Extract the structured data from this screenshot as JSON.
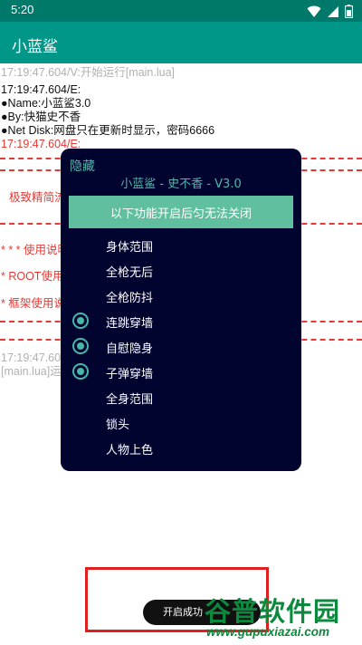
{
  "status_bar": {
    "time": "5:20",
    "icons": [
      "wifi-icon",
      "signal-icon",
      "battery-icon"
    ]
  },
  "app_bar": {
    "title": "小蓝鲨"
  },
  "log": {
    "lines": [
      "17:19:47.604/V:开始运行[main.lua]",
      "17:19:47.604/E:",
      "●Name:小蓝鲨3.0",
      "●By:快猫史不香",
      "●Net Disk:网盘只在更新时显示，密码6666",
      "17:19:47.604/E:",
      "极致精简流",
      "* * * 使用说明",
      "* ROOT使用",
      "* 框架使用说",
      "17:19:47.60",
      "[main.lua]运"
    ]
  },
  "dialog": {
    "hide_label": "隐藏",
    "title": "小蓝鲨 - 史不香 - V3.0",
    "banner": "以下功能开启后匀无法关闭",
    "options": [
      {
        "label": "身体范围",
        "checked": false
      },
      {
        "label": "全枪无后",
        "checked": false
      },
      {
        "label": "全枪防抖",
        "checked": false
      },
      {
        "label": "连跳穿墙",
        "checked": true
      },
      {
        "label": "自慰隐身",
        "checked": true
      },
      {
        "label": "子弹穿墙",
        "checked": true
      },
      {
        "label": "全身范围",
        "checked": false
      },
      {
        "label": "锁头",
        "checked": false
      },
      {
        "label": "人物上色",
        "checked": false
      }
    ]
  },
  "toast": {
    "text": "开启成功"
  },
  "watermark": {
    "name": "谷普软件园",
    "url": "www.gupuxiazai.com"
  },
  "colors": {
    "status_bar": "#00796b",
    "app_bar": "#009688",
    "dialog_bg": "#020430",
    "accent": "#45b8a6",
    "log_red": "#e53935"
  }
}
